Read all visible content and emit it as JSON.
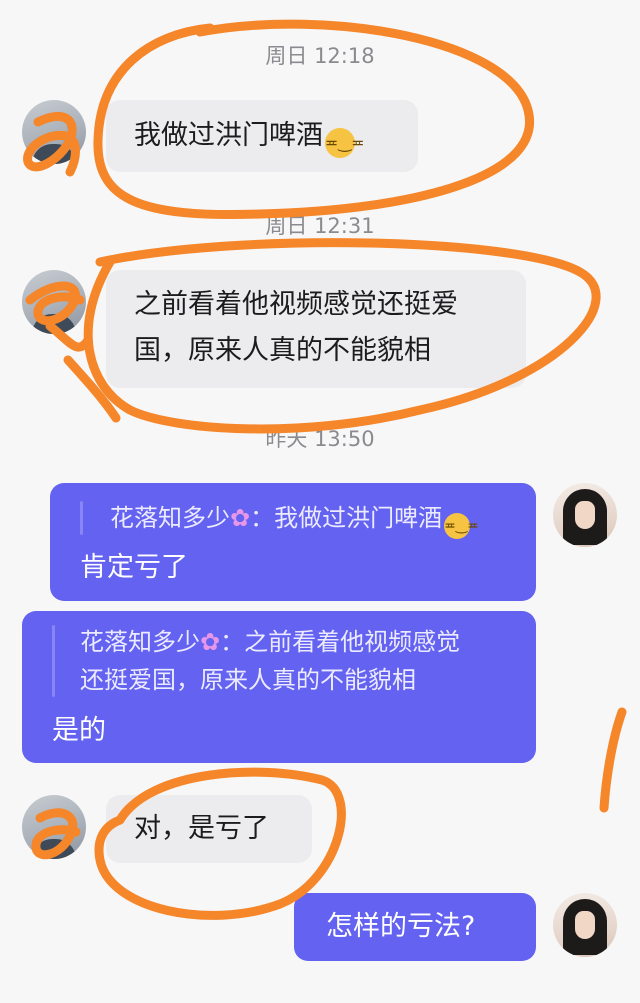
{
  "messages": {
    "m1": {
      "time": "周日 12:18",
      "text": "我做过洪门啤酒"
    },
    "m2": {
      "time": "周日 12:31",
      "line1": "之前看着他视频感觉还挺爱",
      "line2": "国，原来人真的不能貌相"
    },
    "m3": {
      "time": "昨天 13:50"
    },
    "r1": {
      "quote_author": "花落知多少",
      "quote_sep": "：",
      "quote_text": "我做过洪门啤酒",
      "text": "肯定亏了"
    },
    "r2": {
      "quote_author": "花落知多少",
      "quote_sep": "：",
      "quote_line1": "之前看着他视频感觉",
      "quote_line2": "还挺爱国，原来人真的不能貌相",
      "text": "是的"
    },
    "m4": {
      "text": "对，是亏了"
    },
    "r3": {
      "text": "怎样的亏法?"
    }
  },
  "icons": {
    "flower": "✿",
    "emoji_face": "≖‿≖"
  },
  "colors": {
    "outgoing_bubble": "#6462f0",
    "incoming_bubble": "#ececef",
    "annotation_orange": "#f5862a"
  }
}
